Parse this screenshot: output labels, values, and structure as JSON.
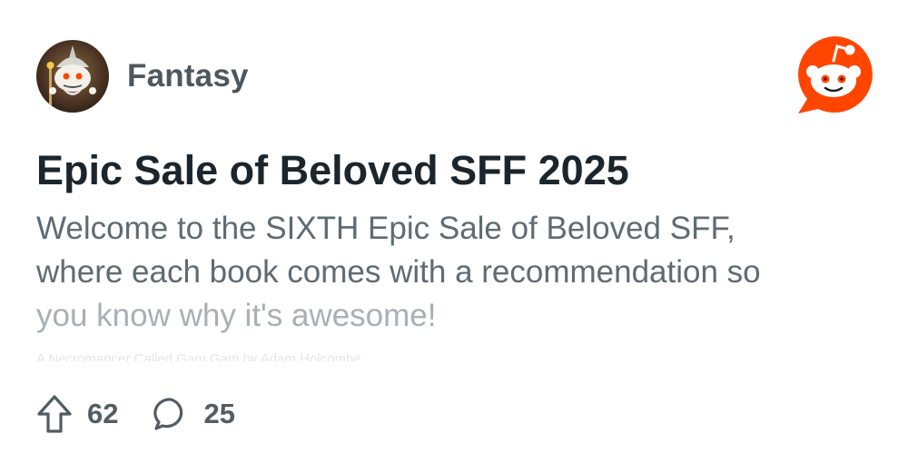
{
  "community": {
    "name": "Fantasy",
    "avatar_icon": "wizard-snoo-avatar-icon"
  },
  "brand": {
    "logo_icon": "reddit-snoo-logo-icon",
    "accent_color": "#ff4500"
  },
  "post": {
    "title": "Epic Sale of Beloved SFF 2025",
    "body_lines": [
      "Welcome to the SIXTH Epic Sale of Beloved SFF,",
      "where each book comes with a recommendation so",
      "you know why it's awesome!"
    ],
    "snippet": "A Necromancer Called Gam Gam by Adam Holcombe"
  },
  "actions": {
    "upvote_count": "62",
    "comment_count": "25",
    "upvote_icon": "upvote-arrow-icon",
    "comment_icon": "comment-bubble-icon"
  }
}
